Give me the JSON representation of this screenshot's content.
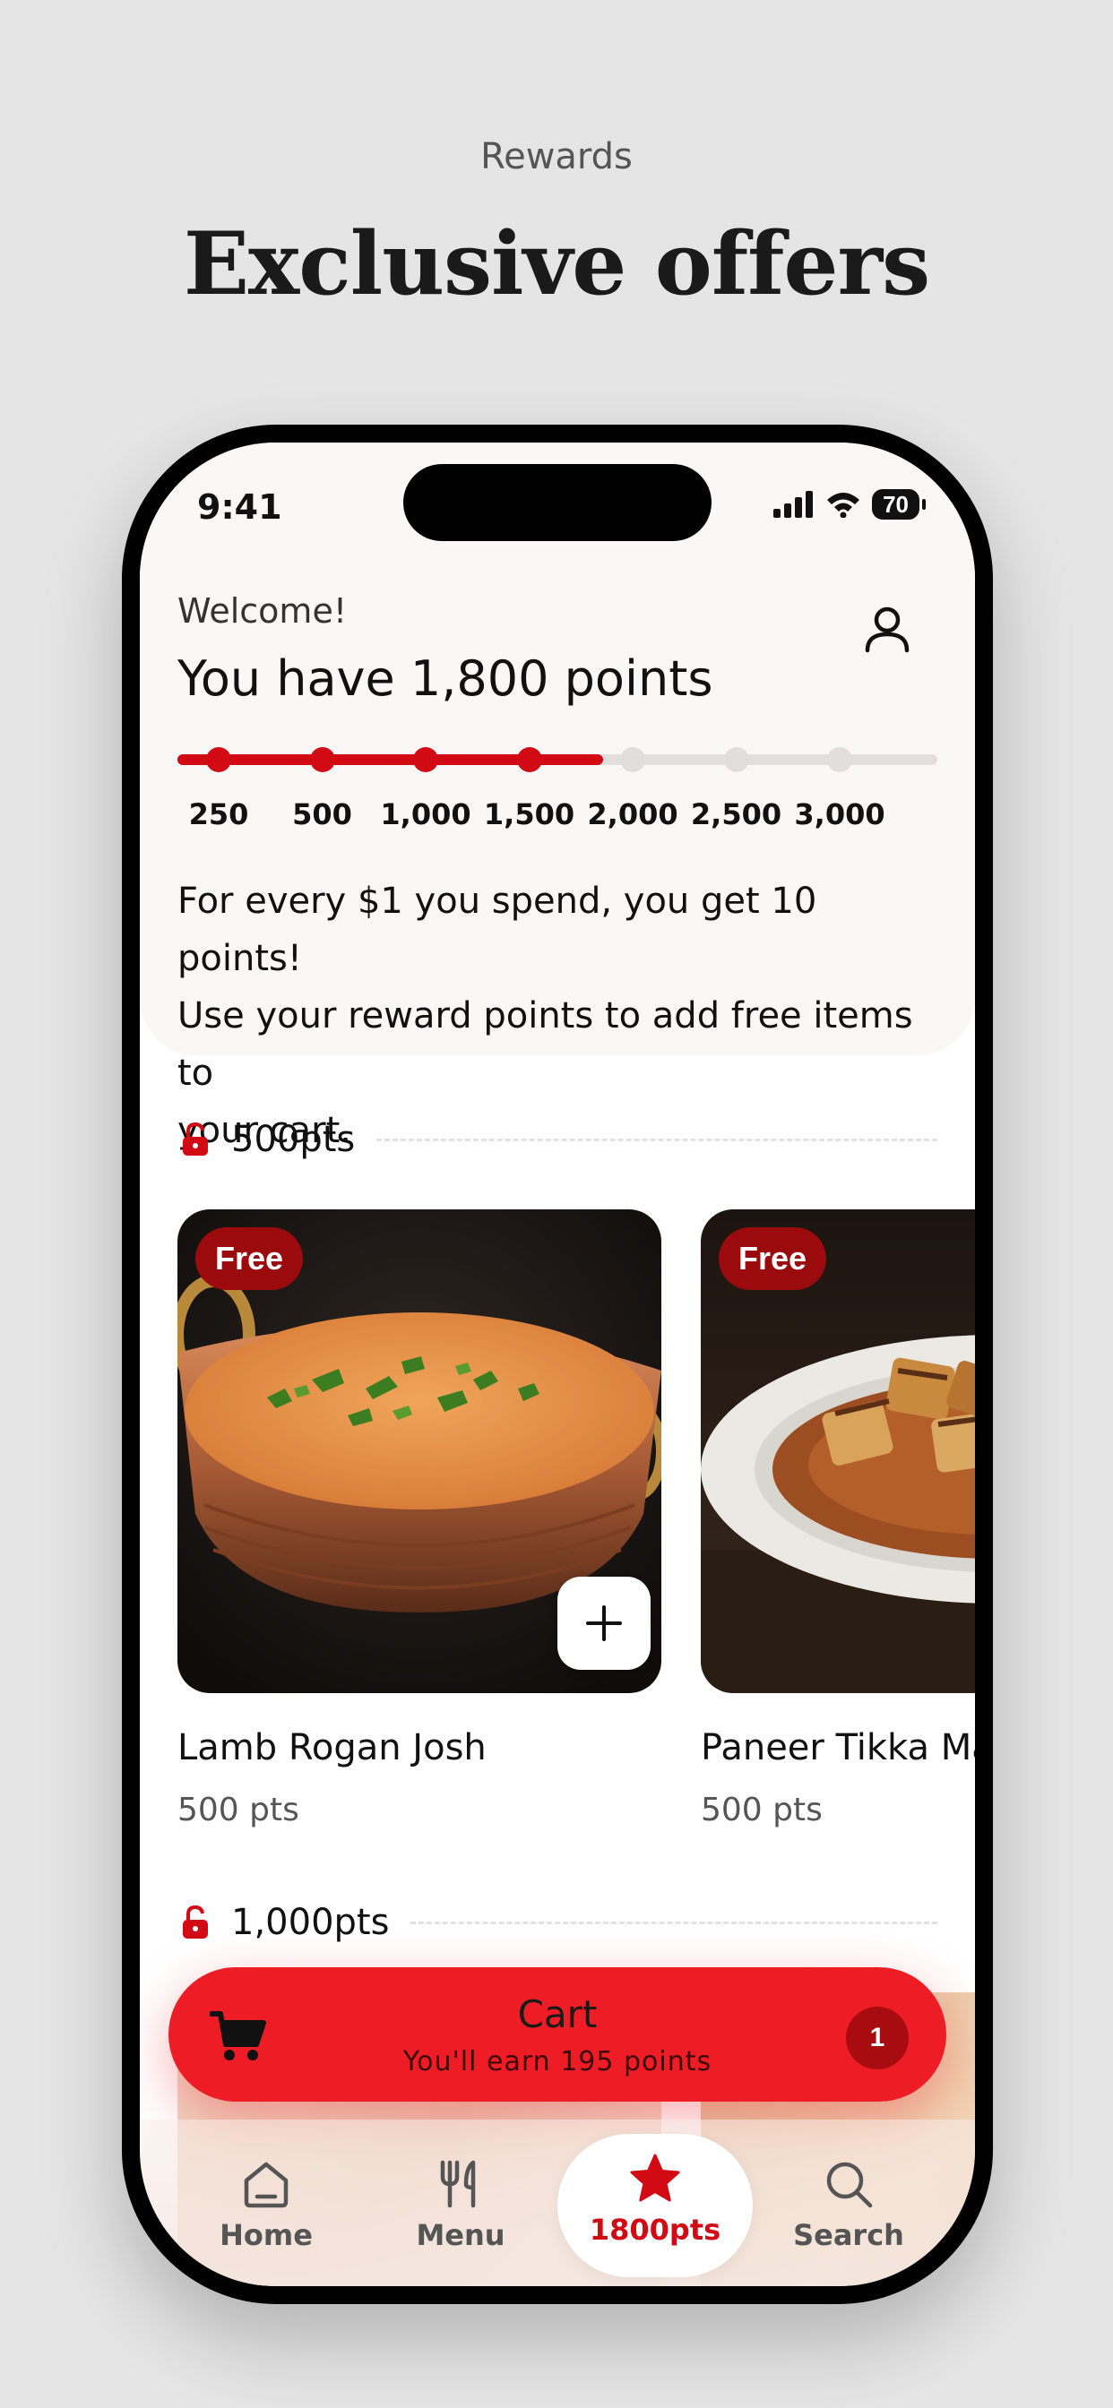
{
  "promo": {
    "label": "Rewards",
    "title": "Exclusive offers"
  },
  "status_bar": {
    "time": "9:41",
    "battery": "70"
  },
  "header": {
    "welcome": "Welcome!",
    "points_heading": "You have 1,800 points",
    "profile_icon": "user-icon"
  },
  "progress": {
    "current_points": 1800,
    "milestones": [
      "250",
      "500",
      "1,000",
      "1,500",
      "2,000",
      "2,500",
      "3,000"
    ],
    "unlocked_count": 4,
    "filled_fraction": 0.56
  },
  "description": {
    "line1": "For every $1 you spend, you get 10 points!",
    "line2": "Use your reward points to add free items to",
    "line3": "your cart."
  },
  "sections": [
    {
      "label": "500pts",
      "icon": "unlock-icon"
    },
    {
      "label": "1,000pts",
      "icon": "unlock-icon"
    }
  ],
  "items": [
    {
      "badge": "Free",
      "name": "Lamb Rogan Josh",
      "points": "500 pts"
    },
    {
      "badge": "Free",
      "name": "Paneer Tikka Masala",
      "points": "500 pts"
    }
  ],
  "cart": {
    "title": "Cart",
    "subtitle": "You'll earn 195 points",
    "count": "1"
  },
  "nav": [
    {
      "label": "Home",
      "icon": "home-icon"
    },
    {
      "label": "Menu",
      "icon": "utensils-icon"
    },
    {
      "label": "1800pts",
      "icon": "star-icon"
    },
    {
      "label": "Search",
      "icon": "search-icon"
    }
  ],
  "colors": {
    "accent": "#ee1c25",
    "accent_dark": "#d20a14",
    "badge": "#9b0a0d",
    "panel": "#faf7f7",
    "background": "#e5e5e5"
  }
}
